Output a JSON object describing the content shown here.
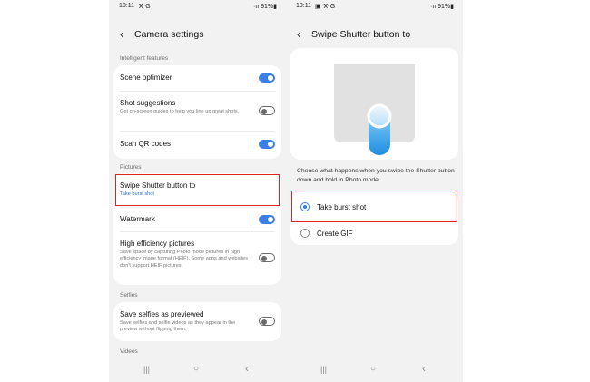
{
  "left_screen": {
    "status": {
      "time": "10:11",
      "icons": "⚒ G",
      "right": "·ıı 91%▮"
    },
    "title": "Camera settings",
    "sections": {
      "intelligent": "Intelligent features",
      "pictures": "Pictures",
      "selfies": "Selfies",
      "videos": "Videos"
    },
    "items": {
      "scene_optimizer": {
        "title": "Scene optimizer",
        "on": true
      },
      "shot_suggestions": {
        "title": "Shot suggestions",
        "sub": "Get on-screen guides to help you line up great shots.",
        "on": false
      },
      "scan_qr": {
        "title": "Scan QR codes",
        "on": true
      },
      "swipe_shutter": {
        "title": "Swipe Shutter button to",
        "sub": "Take burst shot"
      },
      "watermark": {
        "title": "Watermark",
        "on": true
      },
      "high_efficiency": {
        "title": "High efficiency pictures",
        "sub": "Save space by capturing Photo mode pictures in high efficiency image format (HEIF). Some apps and websites don't support HEIF pictures.",
        "on": false
      },
      "save_selfies": {
        "title": "Save selfies as previewed",
        "sub": "Save selfies and selfie videos as they appear in the preview without flipping them.",
        "on": false
      }
    }
  },
  "right_screen": {
    "status": {
      "time": "10:11",
      "icons": "▣ ⚒ G",
      "right": "·ıı 91%▮"
    },
    "title": "Swipe Shutter button to",
    "description": "Choose what happens when you swipe the Shutter button down and hold in Photo mode.",
    "options": [
      {
        "label": "Take burst shot",
        "selected": true
      },
      {
        "label": "Create GIF",
        "selected": false
      }
    ]
  },
  "nav": {
    "recents": "|||",
    "home": "○",
    "back": "‹"
  },
  "colors": {
    "accent": "#3a7ee8",
    "highlight": "#e02222",
    "background": "#f2f2f2",
    "card": "#ffffff"
  }
}
